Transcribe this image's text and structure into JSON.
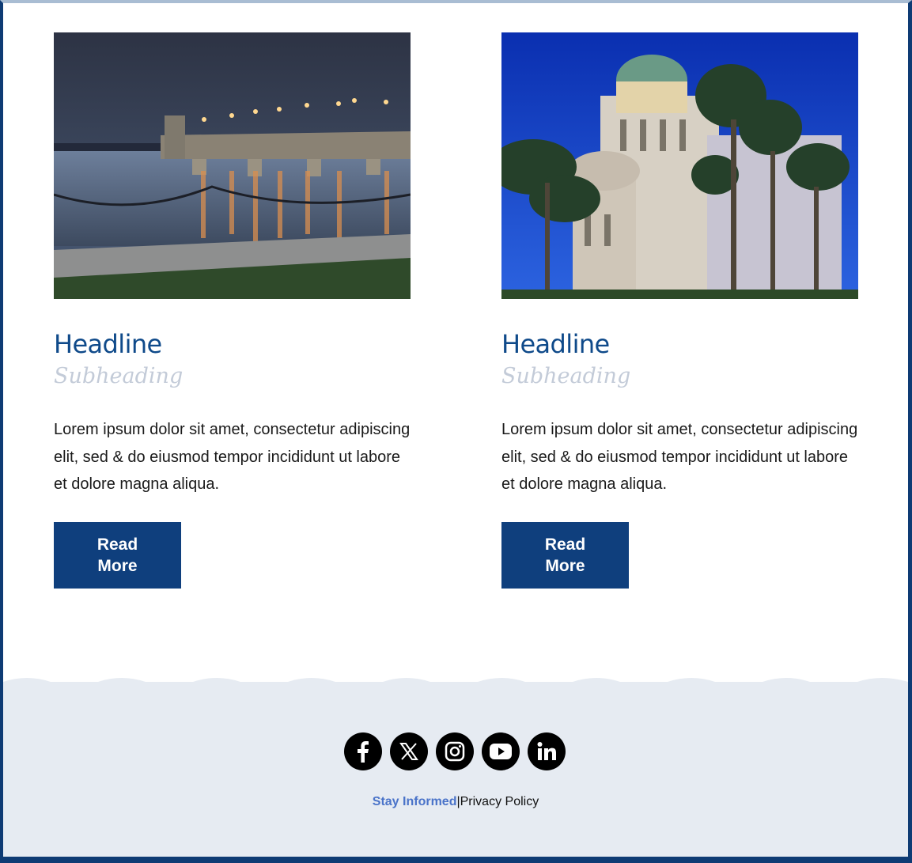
{
  "cards": [
    {
      "headline": "Headline",
      "subheading": "Subheading",
      "body": "Lorem ipsum dolor sit amet, consectetur adipiscing elit, sed & do eiusmod tempor incididunt ut labore et dolore magna aliqua.",
      "button_label": "Read More",
      "image": "bridge-at-dusk-photo"
    },
    {
      "headline": "Headline",
      "subheading": "Subheading",
      "body": "Lorem ipsum dolor sit amet, consectetur adipiscing elit, sed & do eiusmod tempor incididunt ut labore et dolore magna aliqua.",
      "button_label": "Read More",
      "image": "cathedral-and-palms-photo"
    }
  ],
  "footer": {
    "social_icons": [
      "facebook-icon",
      "x-icon",
      "instagram-icon",
      "youtube-icon",
      "linkedin-icon"
    ],
    "stay_informed": "Stay Informed",
    "separator": "|",
    "privacy_policy": "Privacy Policy"
  },
  "colors": {
    "brand_blue": "#0f3f7d",
    "headline_blue": "#0f4a8a",
    "link_blue": "#4a73c9",
    "footer_bg": "#e6ebf2"
  }
}
